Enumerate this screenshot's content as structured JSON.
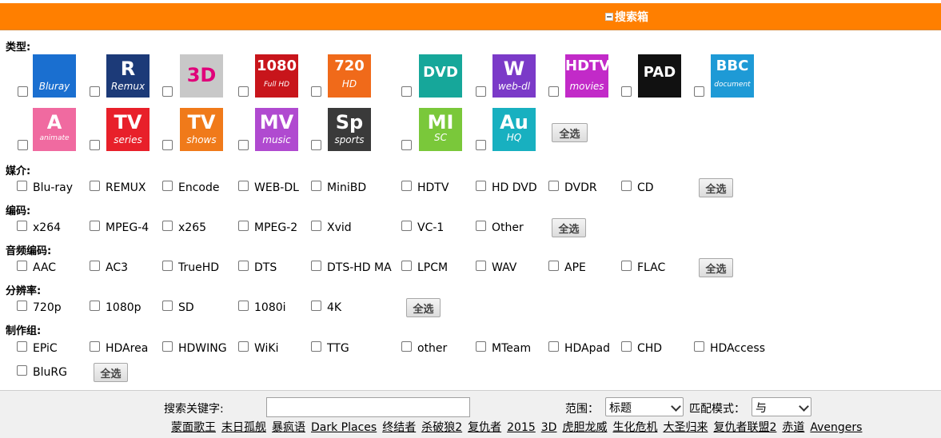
{
  "header": {
    "title": "搜索箱"
  },
  "sections": {
    "type": {
      "label": "类型:",
      "select_all": "全选",
      "icons": [
        {
          "name": "bluray",
          "line1": "",
          "line2": "Bluray",
          "bg": "#1a6fd0",
          "fg": "#fff"
        },
        {
          "name": "remux",
          "line1": "R",
          "line2": "Remux",
          "bg": "#1c3a78",
          "fg": "#fff"
        },
        {
          "name": "3d",
          "line1": "3D",
          "line2": "",
          "bg": "#c8c8c8",
          "fg": "#e0007a"
        },
        {
          "name": "1080-full-hd",
          "line1": "1080",
          "line2": "Full HD",
          "bg": "#c8151b",
          "fg": "#fff"
        },
        {
          "name": "720-hd",
          "line1": "720",
          "line2": "HD",
          "bg": "#f06a1a",
          "fg": "#fff"
        },
        {
          "name": "dvd",
          "line1": "DVD",
          "line2": "",
          "bg": "#16a79a",
          "fg": "#fff"
        },
        {
          "name": "web-dl",
          "line1": "W",
          "line2": "web-dl",
          "bg": "#7b3ac8",
          "fg": "#fff"
        },
        {
          "name": "hdtv-movies",
          "line1": "HDTV",
          "line2": "movies",
          "bg": "#c22ac8",
          "fg": "#fff"
        },
        {
          "name": "pad",
          "line1": "PAD",
          "line2": "",
          "bg": "#111111",
          "fg": "#fff"
        },
        {
          "name": "bbc-document",
          "line1": "BBC",
          "line2": "document",
          "bg": "#1e9ad6",
          "fg": "#fff"
        },
        {
          "name": "animate",
          "line1": "A",
          "line2": "animate",
          "bg": "#f06aa0",
          "fg": "#fff"
        },
        {
          "name": "tv-series",
          "line1": "TV",
          "line2": "series",
          "bg": "#e8202a",
          "fg": "#fff"
        },
        {
          "name": "tv-shows",
          "line1": "TV",
          "line2": "shows",
          "bg": "#f07a1a",
          "fg": "#fff"
        },
        {
          "name": "mv-music",
          "line1": "MV",
          "line2": "music",
          "bg": "#b04ad0",
          "fg": "#fff"
        },
        {
          "name": "sp-sports",
          "line1": "Sp",
          "line2": "sports",
          "bg": "#3a3a3a",
          "fg": "#fff"
        },
        {
          "name": "misc",
          "line1": "MI",
          "line2": "SC",
          "bg": "#7ac83a",
          "fg": "#fff"
        },
        {
          "name": "au-hq",
          "line1": "Au",
          "line2": "HQ",
          "bg": "#18b0c0",
          "fg": "#fff"
        }
      ]
    },
    "medium": {
      "label": "媒介:",
      "select_all": "全选",
      "options": [
        "Blu-ray",
        "REMUX",
        "Encode",
        "WEB-DL",
        "MiniBD",
        "HDTV",
        "HD DVD",
        "DVDR",
        "CD"
      ]
    },
    "codec": {
      "label": "编码:",
      "select_all": "全选",
      "options": [
        "x264",
        "MPEG-4",
        "x265",
        "MPEG-2",
        "Xvid",
        "VC-1",
        "Other"
      ]
    },
    "audio": {
      "label": "音频编码:",
      "select_all": "全选",
      "options": [
        "AAC",
        "AC3",
        "TrueHD",
        "DTS",
        "DTS-HD MA",
        "LPCM",
        "WAV",
        "APE",
        "FLAC"
      ]
    },
    "resolution": {
      "label": "分辨率:",
      "select_all": "全选",
      "options": [
        "720p",
        "1080p",
        "SD",
        "1080i",
        "4K"
      ]
    },
    "team": {
      "label": "制作组:",
      "select_all": "全选",
      "options": [
        "EPiC",
        "HDArea",
        "HDWING",
        "WiKi",
        "TTG",
        "other",
        "MTeam",
        "HDApad",
        "CHD",
        "HDAccess",
        "BluRG"
      ]
    }
  },
  "search": {
    "keyword_label": "搜索关键字:",
    "keyword_value": "",
    "scope_label": "范围：",
    "scope_value": "标题",
    "mode_label": "匹配模式：",
    "mode_value": "与"
  },
  "hot_keywords": [
    "蒙面歌王",
    "末日孤舰",
    "暴疯语",
    "Dark Places",
    "终结者",
    "杀破狼2",
    "复仇者",
    "2015",
    "3D",
    "虎胆龙威",
    "生化危机",
    "大圣归来",
    "复仇者联盟2",
    "赤道",
    "Avengers"
  ]
}
